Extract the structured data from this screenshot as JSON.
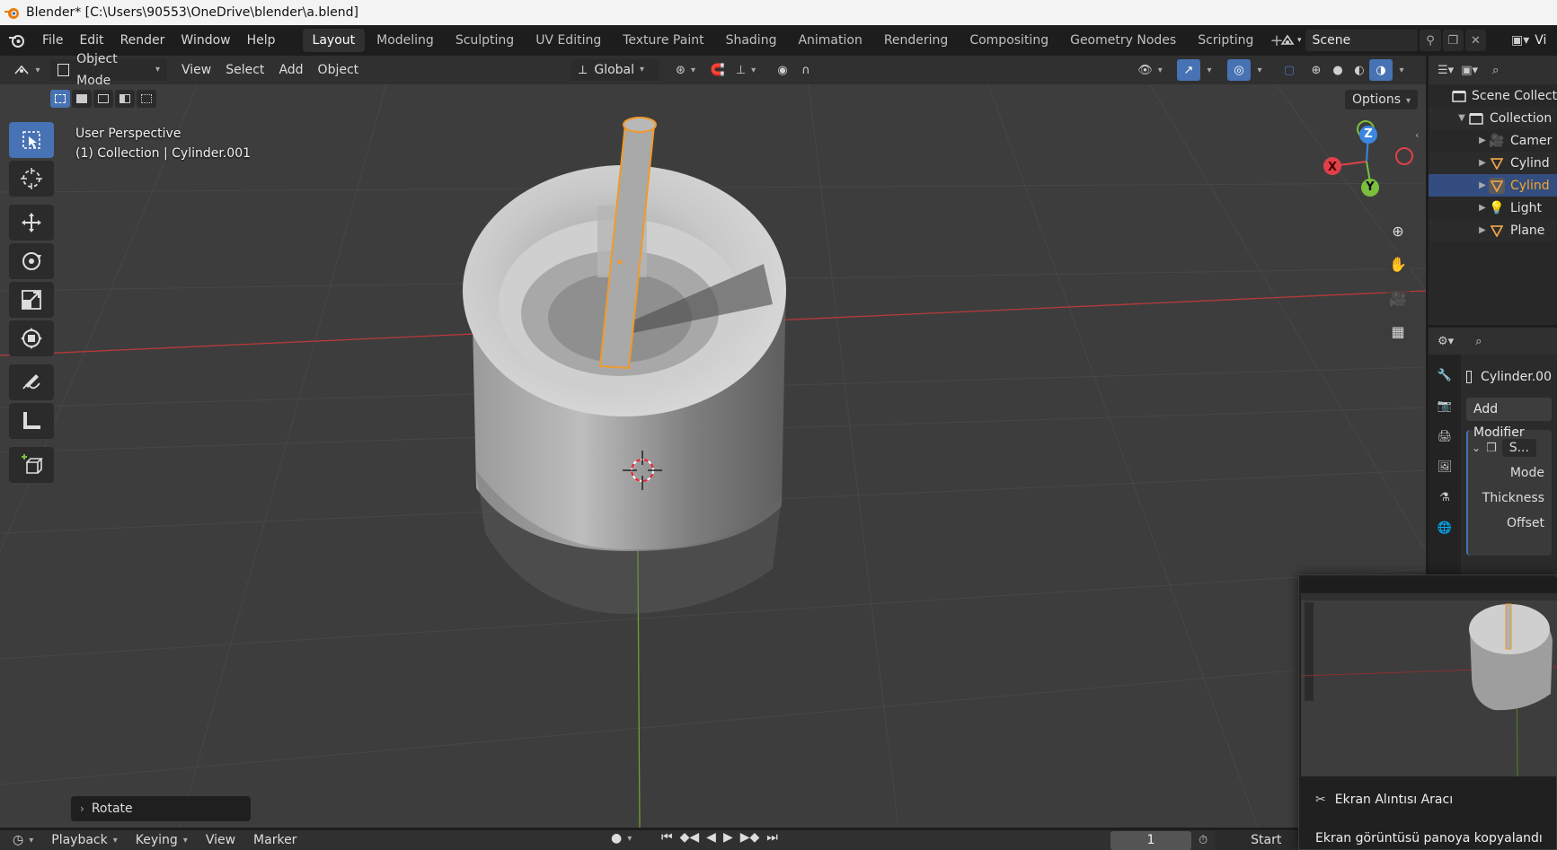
{
  "window": {
    "title": "Blender* [C:\\Users\\90553\\OneDrive\\blender\\a.blend]"
  },
  "menu": [
    "File",
    "Edit",
    "Render",
    "Window",
    "Help"
  ],
  "workspaces": [
    {
      "label": "Layout",
      "active": true
    },
    {
      "label": "Modeling"
    },
    {
      "label": "Sculpting"
    },
    {
      "label": "UV Editing"
    },
    {
      "label": "Texture Paint"
    },
    {
      "label": "Shading"
    },
    {
      "label": "Animation"
    },
    {
      "label": "Rendering"
    },
    {
      "label": "Compositing"
    },
    {
      "label": "Geometry Nodes"
    },
    {
      "label": "Scripting"
    }
  ],
  "scene": {
    "name": "Scene",
    "view_layer_label": "Vi"
  },
  "viewport_header": {
    "mode": "Object Mode",
    "menus": [
      "View",
      "Select",
      "Add",
      "Object"
    ],
    "orientation": "Global"
  },
  "viewport": {
    "options_label": "Options",
    "info_line1": "User Perspective",
    "info_line2": "(1) Collection | Cylinder.001",
    "gizmo": {
      "x": "X",
      "y": "Y",
      "z": "Z"
    },
    "last_operator": "Rotate"
  },
  "colors": {
    "accent": "#4772b3",
    "selection_outline": "#f09a2c",
    "axis_x": "#e0404a",
    "axis_y": "#7bbf3c",
    "axis_z": "#3b86e0"
  },
  "timeline": {
    "menus": [
      "Playback",
      "Keying",
      "View",
      "Marker"
    ],
    "current_frame": "1",
    "start_label": "Start"
  },
  "outliner": {
    "items": [
      {
        "label": "Scene Collecti",
        "icon": "collection-icon"
      },
      {
        "label": "Collection",
        "icon": "collection-icon"
      },
      {
        "label": "Camer",
        "icon": "camera-icon"
      },
      {
        "label": "Cylind",
        "icon": "mesh-icon"
      },
      {
        "label": "Cylind",
        "icon": "mesh-icon",
        "selected": true
      },
      {
        "label": "Light",
        "icon": "light-icon"
      },
      {
        "label": "Plane",
        "icon": "mesh-icon"
      }
    ]
  },
  "properties": {
    "object_name": "Cylinder.00",
    "add_modifier": "Add Modifier",
    "modifier_name": "S...",
    "fields": [
      "Mode",
      "Thickness",
      "Offset"
    ]
  },
  "toast": {
    "title": "Ekran Alıntısı Aracı",
    "body": "Ekran görüntüsü panoya kopyalandı"
  }
}
